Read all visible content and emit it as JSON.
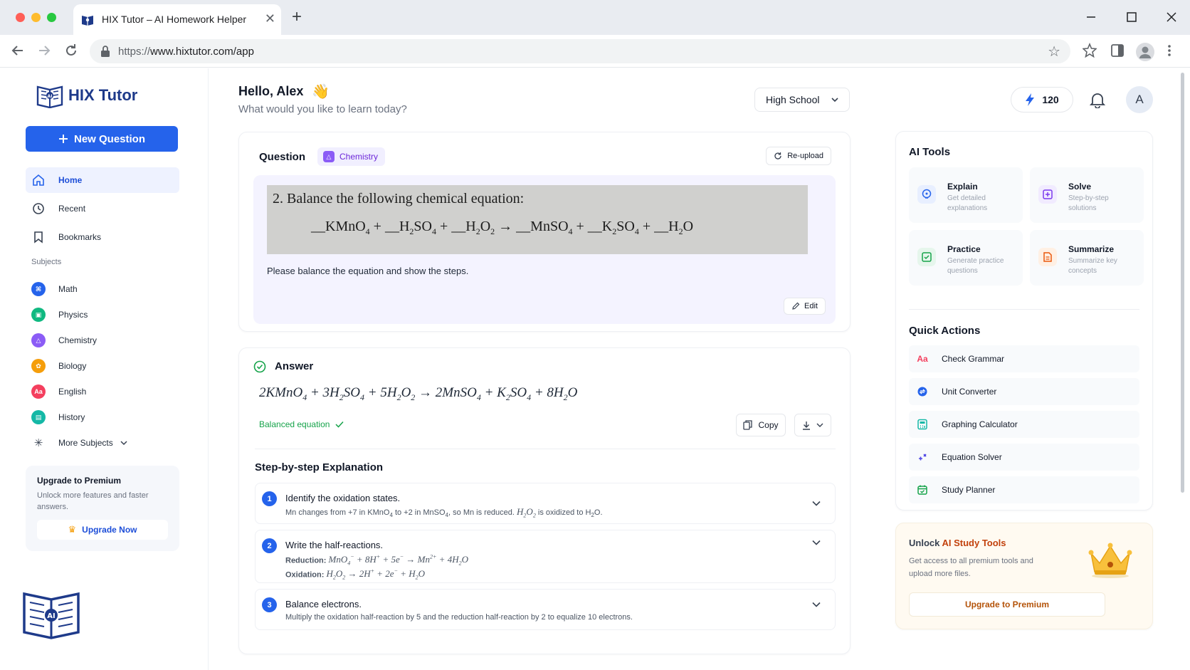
{
  "browser": {
    "tab_title": "HIX Tutor – AI Homework Helper",
    "tab_close": "✕",
    "new_tab": "+",
    "url_prefix": "https://",
    "url_main": "www.hixtutor.com/app",
    "window_controls": [
      "minimize",
      "maximize",
      "close"
    ]
  },
  "sidebar": {
    "brand": "HIX Tutor",
    "new_question": "New Question",
    "nav": [
      {
        "label": "Home",
        "icon": "home-icon",
        "active": true
      },
      {
        "label": "Recent",
        "icon": "clock-icon",
        "active": false
      },
      {
        "label": "Bookmarks",
        "icon": "bookmark-icon",
        "active": false
      }
    ],
    "subjects_label": "Subjects",
    "subjects": [
      {
        "label": "Math",
        "icon": "math-icon",
        "color": "#2563eb"
      },
      {
        "label": "Physics",
        "icon": "physics-icon",
        "color": "#10b981"
      },
      {
        "label": "Chemistry",
        "icon": "chemistry-icon",
        "color": "#8b5cf6"
      },
      {
        "label": "Biology",
        "icon": "biology-icon",
        "color": "#f59e0b"
      },
      {
        "label": "English",
        "icon": "english-icon",
        "color": "#f43f5e"
      },
      {
        "label": "History",
        "icon": "history-icon",
        "color": "#14b8a6"
      }
    ],
    "more_subjects": "More Subjects",
    "premium": {
      "title": "Upgrade to Premium",
      "subtitle": "Unlock more features and faster answers.",
      "button": "Upgrade Now"
    }
  },
  "header": {
    "greeting": "Hello, Alex",
    "wave": "👋",
    "subtitle": "What would you like to learn today?",
    "level": "High School",
    "credits": "120",
    "avatar_initial": "A"
  },
  "question": {
    "title": "Question",
    "subject_tag": "Chemistry",
    "reupload": "Re-upload",
    "image_line1": "2. Balance the following chemical equation:",
    "text": "Please balance the equation and show the steps.",
    "edit": "Edit"
  },
  "answer": {
    "title": "Answer",
    "balanced_label": "Balanced equation",
    "copy": "Copy",
    "steps_title": "Step-by-step Explanation",
    "steps": [
      {
        "num": "1",
        "title": "Identify the oxidation states."
      },
      {
        "num": "2",
        "title": "Write the half-reactions.",
        "reduction_label": "Reduction:",
        "oxidation_label": "Oxidation:"
      },
      {
        "num": "3",
        "title": "Balance electrons.",
        "desc": "Multiply the oxidation half-reaction by 5 and the reduction half-reaction by 2 to equalize 10 electrons."
      }
    ]
  },
  "ai_tools": {
    "title": "AI Tools",
    "tools": [
      {
        "name": "Explain",
        "desc": "Get detailed explanations",
        "icon": "explain-icon",
        "color": "#2563eb"
      },
      {
        "name": "Solve",
        "desc": "Step-by-step solutions",
        "icon": "solve-icon",
        "color": "#7c3aed"
      },
      {
        "name": "Practice",
        "desc": "Generate practice questions",
        "icon": "practice-icon",
        "color": "#16a34a"
      },
      {
        "name": "Summarize",
        "desc": "Summarize key concepts",
        "icon": "summarize-icon",
        "color": "#ea580c"
      }
    ],
    "quick_title": "Quick Actions",
    "quick": [
      {
        "label": "Check Grammar",
        "icon": "grammar-icon"
      },
      {
        "label": "Unit Converter",
        "icon": "unit-converter-icon"
      },
      {
        "label": "Graphing Calculator",
        "icon": "graphing-calculator-icon"
      },
      {
        "label": "Equation Solver",
        "icon": "equation-solver-icon"
      },
      {
        "label": "Study Planner",
        "icon": "study-planner-icon"
      }
    ]
  },
  "unlock": {
    "title_prefix": "Unlock ",
    "title_highlight": "AI Study Tools",
    "subtitle": "Get access to all premium tools and upload more files.",
    "button": "Upgrade to Premium"
  },
  "colors": {
    "primary": "#2563eb",
    "success": "#16a34a",
    "chemistry": "#6d28d9",
    "premium_accent": "#c2410c"
  }
}
